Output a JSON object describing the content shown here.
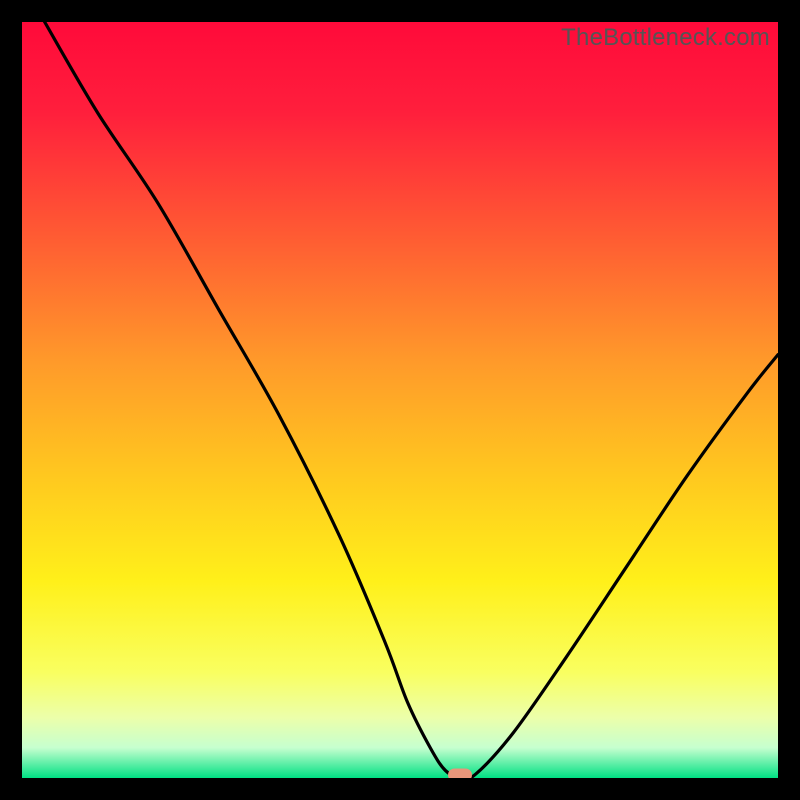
{
  "watermark": "TheBottleneck.com",
  "chart_data": {
    "type": "line",
    "title": "",
    "xlabel": "",
    "ylabel": "",
    "xlim": [
      0,
      100
    ],
    "ylim": [
      0,
      100
    ],
    "x": [
      3,
      10,
      18,
      26,
      34,
      42,
      48,
      51,
      54,
      56,
      58,
      60,
      65,
      72,
      80,
      88,
      96,
      100
    ],
    "y": [
      100,
      88,
      76,
      62,
      48,
      32,
      18,
      10,
      4,
      1,
      0,
      0.5,
      6,
      16,
      28,
      40,
      51,
      56
    ],
    "minimum_marker": {
      "x": 58,
      "y": 0
    },
    "background_gradient_stops": [
      {
        "pct": 0.0,
        "color": "#ff0a3a"
      },
      {
        "pct": 0.12,
        "color": "#ff1f3c"
      },
      {
        "pct": 0.28,
        "color": "#ff5a33"
      },
      {
        "pct": 0.45,
        "color": "#ff9a2a"
      },
      {
        "pct": 0.6,
        "color": "#ffc81f"
      },
      {
        "pct": 0.74,
        "color": "#fff01a"
      },
      {
        "pct": 0.86,
        "color": "#f9ff60"
      },
      {
        "pct": 0.92,
        "color": "#ecffaa"
      },
      {
        "pct": 0.96,
        "color": "#c6ffcf"
      },
      {
        "pct": 1.0,
        "color": "#00e083"
      }
    ]
  }
}
